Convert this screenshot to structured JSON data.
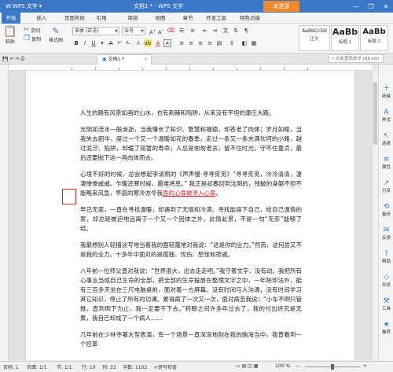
{
  "colors": {
    "accent": "#3b77c6",
    "login": "#f08a2c",
    "markup": "#d9232b"
  },
  "titlebar": {
    "app_name": "WPS 文字",
    "doc_title": "文档1 * - WPS 文字",
    "login_label": "未登录",
    "min": "—",
    "restore": "❐",
    "close": "✕"
  },
  "menu": {
    "items": [
      "开始",
      "插入",
      "页面布局",
      "引用",
      "审阅",
      "视图",
      "章节",
      "开发工具",
      "特色功能"
    ]
  },
  "toolbar": {
    "paste": "粘贴",
    "cut": "剪切",
    "copy": "复制",
    "format_painter": "格式刷",
    "font_name": "宋体 (正文)",
    "font_size": "五号",
    "styles": [
      {
        "sample": "AaBbCcDd",
        "label": "正文"
      },
      {
        "sample": "AaBb",
        "label": "标题 1"
      },
      {
        "sample": "AaBb",
        "label": "标题 2"
      }
    ],
    "new_style": "新样式"
  },
  "tabbar": {
    "doc_tab": "文档1 *",
    "search_placeholder": "点此查找命令 (Alt+Q)"
  },
  "document": {
    "p1": "人生的路有风景如画的山水，也有荆棘和陷阱，从来没有平坦的康庄大路。",
    "p2": "光阴如流水一般淌逝，当我懂长了知识、智慧和福德，却苍老了肉体；岁月如梭，当我失去韶华，度过一个又一个温暖如花的春季，走过一条又一条充满坎坷的小路，越过泥泞、陷阱，却缓了短暂的寿命；人总是匆匆老去，留不住时光，守不住童贞，最后还要抛下这一具肉体而去。",
    "p3_a": "心境不好的时候，总会想起李清照的《声声慢·寻寻觅觅》“寻寻觅觅，冷冷清清，凄凄惨惨戚戚。乍暖还寒时候，最难将息。” 我正是初春回到沈阳的，残破的身躯不但不能略来风急，早晨的寒冷亦令我",
    "p3_red": "面的心扉被寻入心扉",
    "p3_b": "。",
    "p4": "早已无家，一直在寻找温暖，却遇到了无情和冷漠。寻找能容下自己，给自己温情的家，却总是被迫地远离于一个又一个团体之外，此情此景，不是一句“无奈”能够了结。",
    "p5": "我最想别人轻描淡写地当着我的面轻蔑地对我说：“这是你的业力。”然而，这何尝又不是我的业力。十多年中面对的是孤独、忧伤、愁怅和悲戚。",
    "p6": "八年前一位师父曾对我说：“世界很大，出去走走吧。”我守着文字，没有动。我把所有心事业当成自己生命的全部，把全部的生命投放在整理文字之中，一年除却法外，能有三百多天坐在三尺电脑桌前，面对着一方屏幕。没有时间与人沟通，没有时间学习其它知识，停止了所有的功课。累得病了一次又一次，面对病苦我说：“小车不倒只管推，直到倒下为止，我一定要干下去。”转眼之间许多年过去了，我的付出终究是无果，我自己却成了一个病人……",
    "p7": "几年前在少林寺著大型表演，有一个场景一直深深地刻在我的脑海当中，我曾看到一个控革"
  },
  "rightpanel": {
    "items": [
      "新建",
      "样式",
      "选择",
      "属性",
      "分享",
      "备份",
      "反馈",
      "帮助",
      "形状",
      "工具",
      "推荐"
    ]
  },
  "status": {
    "page": "页码: 1",
    "pages": "页面: 1/1",
    "section": "节: 1/1",
    "row": "行: 10",
    "col": "列: 33",
    "words": "字数: 1102",
    "spell": "拼写检查",
    "zoom": "100 %"
  }
}
